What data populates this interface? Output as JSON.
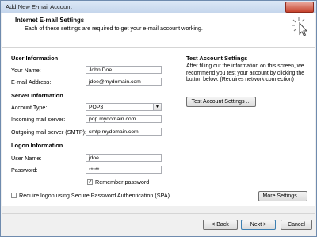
{
  "window": {
    "title": "Add New E-mail Account",
    "close_glyph": "✕"
  },
  "header": {
    "title": "Internet E-mail Settings",
    "subtitle": "Each of these settings are required to get your e-mail account working."
  },
  "user_info": {
    "heading": "User Information",
    "name_label": "Your Name:",
    "name_value": "John Doe",
    "email_label": "E-mail Address:",
    "email_value": "jdoe@mydomain.com"
  },
  "server_info": {
    "heading": "Server Information",
    "account_type_label": "Account Type:",
    "account_type_value": "POP3",
    "incoming_label": "Incoming mail server:",
    "incoming_value": "pop.mydomain.com",
    "outgoing_label": "Outgoing mail server (SMTP):",
    "outgoing_value": "smtp.mydomain.com"
  },
  "logon_info": {
    "heading": "Logon Information",
    "username_label": "User Name:",
    "username_value": "jdoe",
    "password_label": "Password:",
    "password_value": "*****",
    "remember_label": "Remember password",
    "remember_checked": true,
    "spa_label": "Require logon using Secure Password Authentication (SPA)",
    "spa_checked": false
  },
  "test": {
    "heading": "Test Account Settings",
    "description": "After filling out the information on this screen, we recommend you test your account by clicking the button below. (Requires network connection)",
    "button_label": "Test Account Settings ..."
  },
  "buttons": {
    "more_settings": "More Settings ...",
    "back": "< Back",
    "next": "Next >",
    "cancel": "Cancel"
  },
  "icons": {
    "check_glyph": "✔",
    "dropdown_glyph": "▼"
  },
  "colors": {
    "title_bar": "#c5d6ec",
    "close_button": "#c6422c",
    "panel": "#ffffff",
    "frame": "#f0f0f0"
  }
}
